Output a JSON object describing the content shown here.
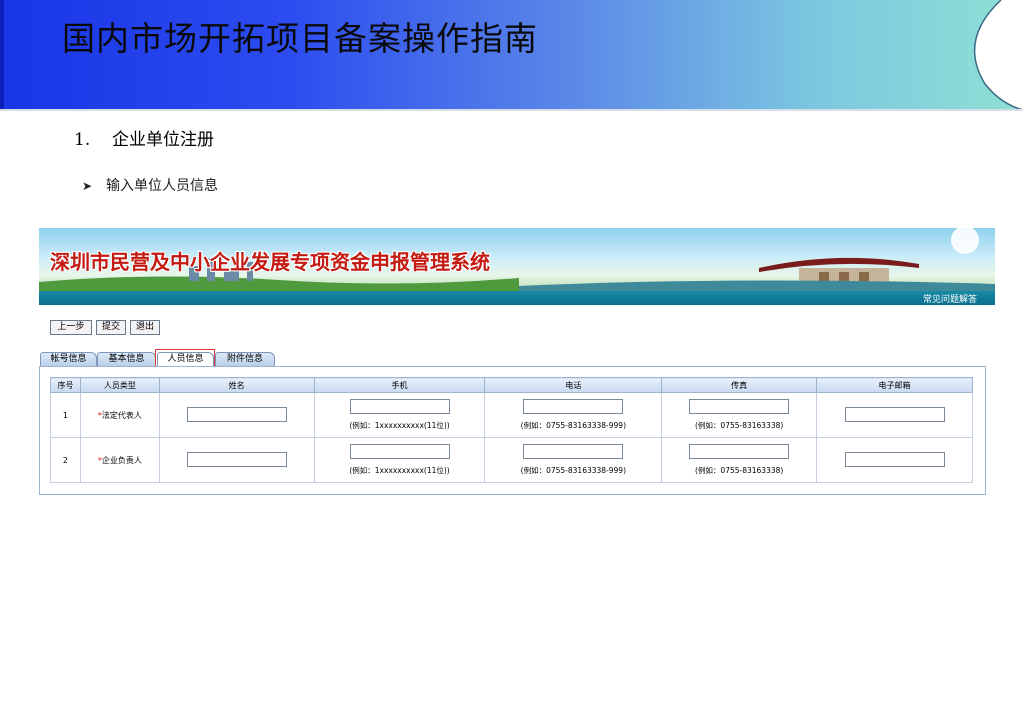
{
  "slide": {
    "title": "国内市场开拓项目备案操作指南",
    "section_number": "1.",
    "section_title": "企业单位注册",
    "bullet_text": "输入单位人员信息"
  },
  "app": {
    "banner_title": "深圳市民营及中小企业发展专项资金申报管理系统",
    "faq_link": "常见问题解答"
  },
  "toolbar": {
    "prev_label": "上一步",
    "submit_label": "提交",
    "exit_label": "退出"
  },
  "tabs": [
    {
      "label": "帐号信息"
    },
    {
      "label": "基本信息"
    },
    {
      "label": "人员信息"
    },
    {
      "label": "附件信息"
    }
  ],
  "active_tab": "人员信息",
  "table": {
    "headers": [
      "序号",
      "人员类型",
      "姓名",
      "手机",
      "电话",
      "传真",
      "电子邮箱"
    ],
    "rows": [
      {
        "index": "1",
        "required_mark": "*",
        "type": "法定代表人",
        "name_value": "",
        "mobile_value": "",
        "mobile_hint": "(例如：1xxxxxxxxxx(11位))",
        "phone_value": "",
        "phone_hint": "(例如：0755-83163338-999)",
        "fax_value": "",
        "fax_hint": "(例如：0755-83163338)",
        "email_value": ""
      },
      {
        "index": "2",
        "required_mark": "*",
        "type": "企业负责人",
        "name_value": "",
        "mobile_value": "",
        "mobile_hint": "(例如：1xxxxxxxxxx(11位))",
        "phone_value": "",
        "phone_hint": "(例如：0755-83163338-999)",
        "fax_value": "",
        "fax_hint": "(例如：0755-83163338)",
        "email_value": ""
      }
    ]
  },
  "colors": {
    "header_blue": "#1836e6",
    "header_teal": "#8fe0d4",
    "banner_title_red": "#c31a12",
    "required_red": "#e01010",
    "highlight_red": "#e0363a"
  }
}
